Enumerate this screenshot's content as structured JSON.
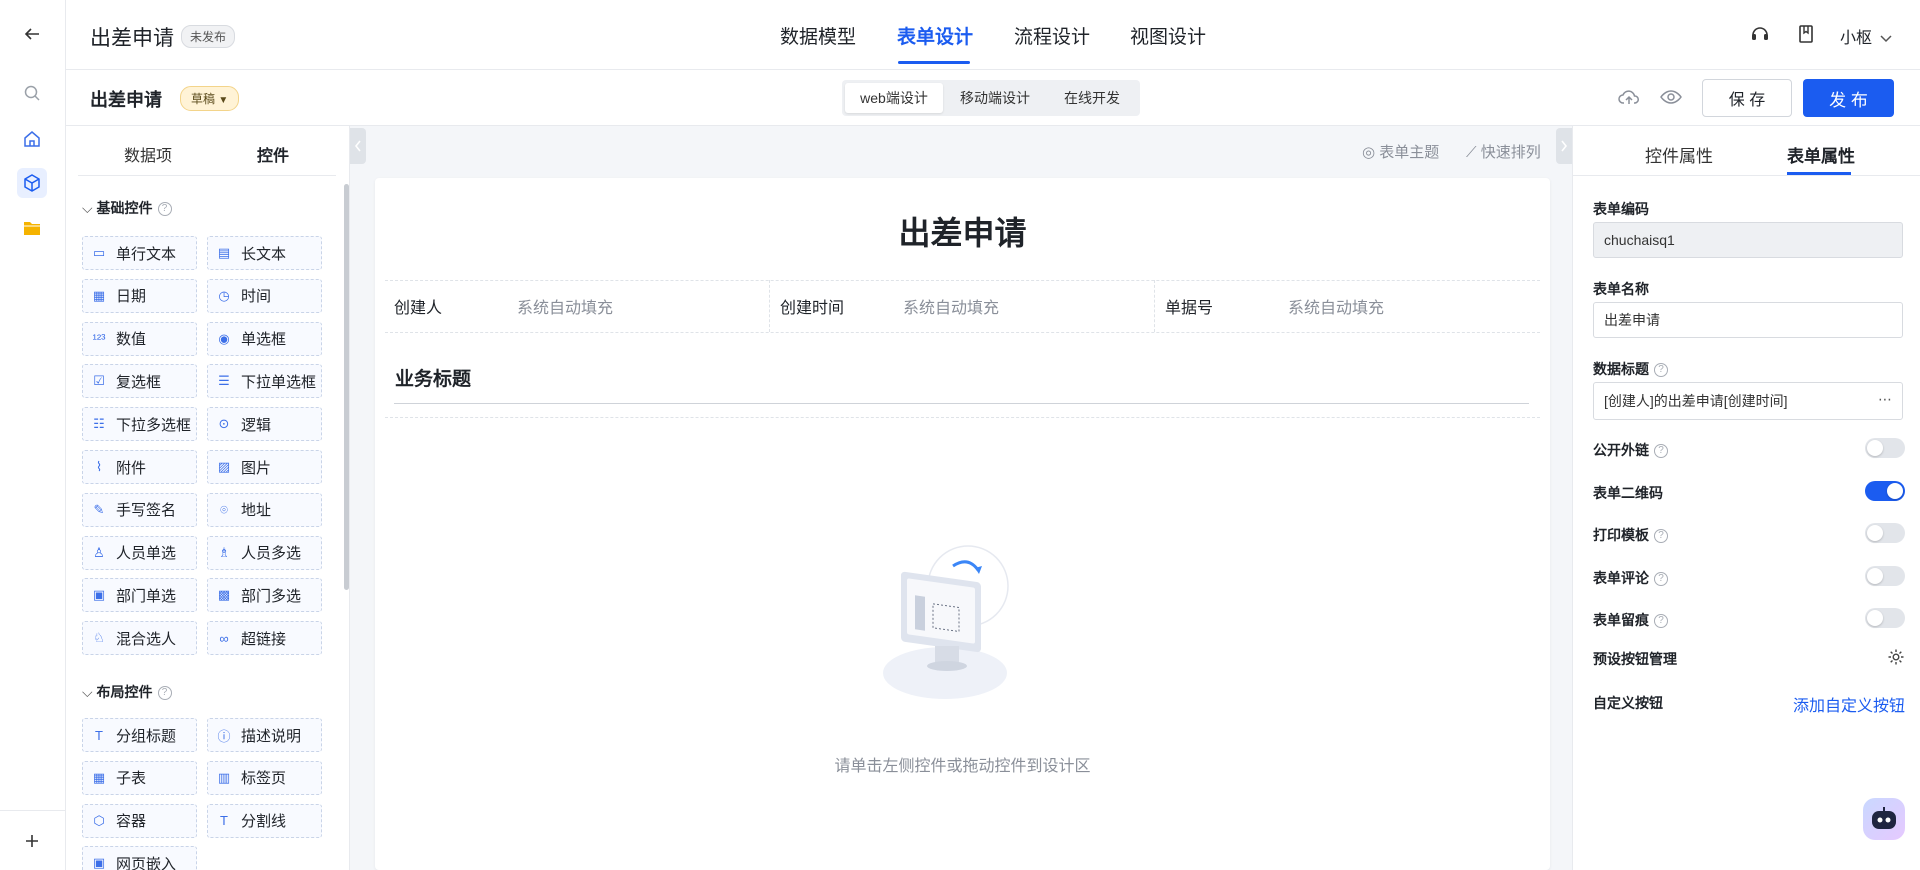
{
  "topbar": {
    "app_title": "出差申请",
    "status_badge": "未发布",
    "nav": [
      "数据模型",
      "表单设计",
      "流程设计",
      "视图设计"
    ],
    "user": "小枢"
  },
  "subbar": {
    "form_name": "出差申请",
    "draft_label": "草稿",
    "segments": [
      "web端设计",
      "移动端设计",
      "在线开发"
    ],
    "save_label": "保 存",
    "publish_label": "发 布"
  },
  "left": {
    "tabs": [
      "数据项",
      "控件"
    ],
    "basic_title": "基础控件",
    "basic_controls": [
      {
        "label": "单行文本",
        "icon": "single-line-text-icon"
      },
      {
        "label": "长文本",
        "icon": "long-text-icon"
      },
      {
        "label": "日期",
        "icon": "calendar-icon"
      },
      {
        "label": "时间",
        "icon": "clock-icon"
      },
      {
        "label": "数值",
        "icon": "number-icon"
      },
      {
        "label": "单选框",
        "icon": "radio-icon"
      },
      {
        "label": "复选框",
        "icon": "checkbox-icon"
      },
      {
        "label": "下拉单选框",
        "icon": "dropdown-single-icon"
      },
      {
        "label": "下拉多选框",
        "icon": "dropdown-multi-icon"
      },
      {
        "label": "逻辑",
        "icon": "toggle-icon"
      },
      {
        "label": "附件",
        "icon": "paperclip-icon"
      },
      {
        "label": "图片",
        "icon": "image-icon"
      },
      {
        "label": "手写签名",
        "icon": "pen-icon"
      },
      {
        "label": "地址",
        "icon": "location-pin-icon"
      },
      {
        "label": "人员单选",
        "icon": "user-icon"
      },
      {
        "label": "人员多选",
        "icon": "users-icon"
      },
      {
        "label": "部门单选",
        "icon": "department-icon"
      },
      {
        "label": "部门多选",
        "icon": "departments-icon"
      },
      {
        "label": "混合选人",
        "icon": "mixed-user-icon"
      },
      {
        "label": "超链接",
        "icon": "link-icon"
      }
    ],
    "layout_title": "布局控件",
    "layout_controls": [
      {
        "label": "分组标题",
        "icon": "group-title-icon"
      },
      {
        "label": "描述说明",
        "icon": "help-circle-icon"
      },
      {
        "label": "子表",
        "icon": "table-icon"
      },
      {
        "label": "标签页",
        "icon": "tabs-icon"
      },
      {
        "label": "容器",
        "icon": "container-icon"
      },
      {
        "label": "分割线",
        "icon": "divider-icon"
      },
      {
        "label": "网页嵌入",
        "icon": "webpage-icon"
      }
    ]
  },
  "canvas": {
    "tool_theme": "表单主题",
    "tool_arrange": "快速排列",
    "form_title": "出差申请",
    "fields": [
      {
        "label": "创建人",
        "value": "系统自动填充"
      },
      {
        "label": "创建时间",
        "value": "系统自动填充"
      },
      {
        "label": "单据号",
        "value": "系统自动填充"
      }
    ],
    "business_title": "业务标题",
    "empty_tip": "请单击左侧控件或拖动控件到设计区"
  },
  "right": {
    "tabs": [
      "控件属性",
      "表单属性"
    ],
    "code_label": "表单编码",
    "code_value": "chuchaisq1",
    "name_label": "表单名称",
    "name_value": "出差申请",
    "data_title_label": "数据标题",
    "data_title_value": "[创建人]的出差申请[创建时间]",
    "toggles": [
      {
        "label": "公开外链",
        "help": true,
        "on": false
      },
      {
        "label": "表单二维码",
        "help": false,
        "on": true
      },
      {
        "label": "打印模板",
        "help": true,
        "on": false
      },
      {
        "label": "表单评论",
        "help": true,
        "on": false
      },
      {
        "label": "表单留痕",
        "help": true,
        "on": false
      }
    ],
    "preset_buttons_label": "预设按钮管理",
    "custom_buttons_label": "自定义按钮",
    "add_custom_label": "添加自定义按钮"
  },
  "colors": {
    "accent": "#1b5cf0",
    "folder": "#f5b300"
  }
}
